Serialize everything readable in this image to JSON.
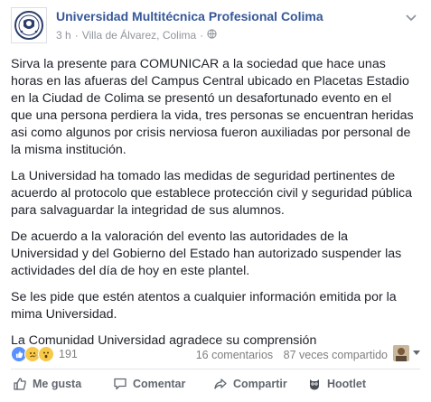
{
  "post": {
    "page_name": "Universidad Multitécnica Profesional Colima",
    "time": "3 h",
    "separator": "·",
    "location": "Villa de Álvarez, Colima",
    "separator2": "·",
    "paragraphs": [
      "Sirva la presente para COMUNICAR a la sociedad que hace unas horas en las afueras del Campus Central ubicado en Placetas Estadio en la Ciudad de Colima se presentó un desafortunado evento en el que una persona perdiera la vida, tres personas se encuentran heridas asi como algunos por crisis nerviosa fueron auxiliadas por personal de la misma institución.",
      "La Universidad ha tomado las medidas de seguridad pertinentes de acuerdo al protocolo que establece protección civil y seguridad pública para salvaguardar la integridad de sus alumnos.",
      "De acuerdo a la valoración del evento las autoridades de la Universidad y del Gobierno del Estado han autorizado suspender las actividades del día de hoy en este plantel.",
      "Se les pide que estén atentos a cualquier información emitida por la mima Universidad.",
      "La Comunidad Universidad agradece su comprensión"
    ]
  },
  "stats": {
    "reaction_count": "191",
    "reaction_icons": [
      "like-icon",
      "sad-icon",
      "wow-icon"
    ],
    "comments": "16 comentarios",
    "shares": "87 veces compartido"
  },
  "actions": {
    "like": "Me gusta",
    "comment": "Comentar",
    "share": "Compartir",
    "hootlet": "Hootlet"
  },
  "colors": {
    "link": "#365899",
    "meta": "#90949c",
    "like_blue": "#5890ff",
    "sad_yellow": "#f7c948"
  }
}
